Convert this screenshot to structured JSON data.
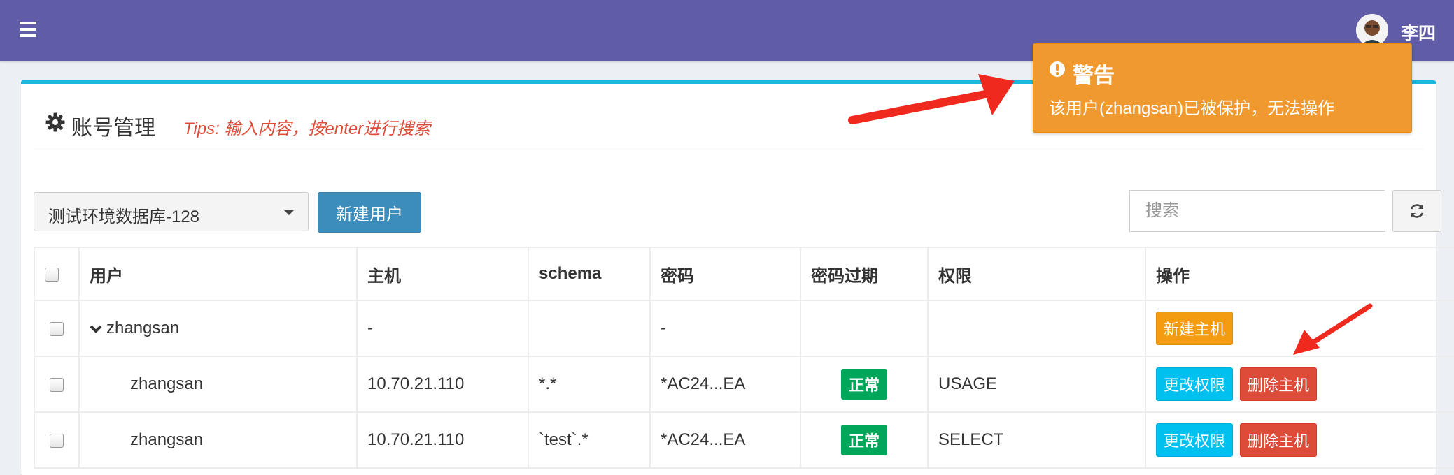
{
  "header": {
    "user_name": "李四"
  },
  "panel": {
    "title": "账号管理",
    "tips": "Tips: 输入内容，按enter进行搜索"
  },
  "toolbar": {
    "database_selected": "测试环境数据库-128",
    "new_user_label": "新建用户",
    "search_placeholder": "搜索"
  },
  "table": {
    "columns": [
      "用户",
      "主机",
      "schema",
      "密码",
      "密码过期",
      "权限",
      "操作"
    ],
    "parent_row": {
      "user": "zhangsan",
      "host": "-",
      "password": "-",
      "action_label": "新建主机"
    },
    "rows": [
      {
        "user": "zhangsan",
        "host": "10.70.21.110",
        "schema": "*.*",
        "password": "*AC24...EA",
        "expiry": "正常",
        "privilege": "USAGE",
        "edit_label": "更改权限",
        "delete_label": "删除主机"
      },
      {
        "user": "zhangsan",
        "host": "10.70.21.110",
        "schema": "`test`.*",
        "password": "*AC24...EA",
        "expiry": "正常",
        "privilege": "SELECT",
        "edit_label": "更改权限",
        "delete_label": "删除主机"
      }
    ]
  },
  "alert": {
    "title": "警告",
    "message": "该用户(zhangsan)已被保护，无法操作"
  },
  "colors": {
    "topbar": "#605ca8",
    "box_top_border": "#1fb5e1",
    "primary": "#3c8dbc",
    "warning": "#f39c12",
    "info": "#00c0ef",
    "danger": "#dd4b39",
    "success": "#00a65a",
    "annotation_arrow": "#f0291f"
  },
  "icons": [
    "menu-icon",
    "avatar",
    "gear-icon",
    "caret-down-icon",
    "refresh-icon",
    "chevron-down-icon",
    "exclamation-circle-icon",
    "annotation-arrow"
  ]
}
